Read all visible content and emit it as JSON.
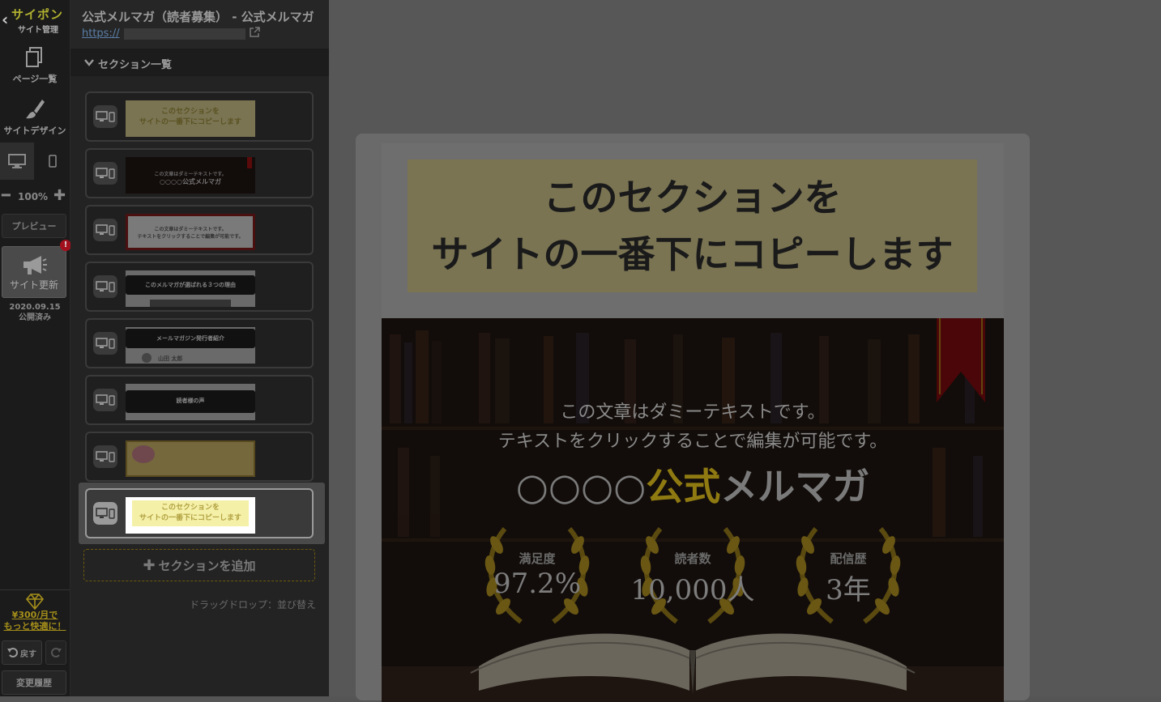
{
  "toolbar": {
    "logo_brand": "サイポン",
    "logo_sub": "サイト管理",
    "pages_label": "ページ一覧",
    "design_label": "サイトデザイン",
    "zoom": "100%",
    "preview_label": "プレビュー",
    "update_label": "サイト更新",
    "alert": "!",
    "update_date": "2020.09.15",
    "update_status": "公開済み",
    "promo_line1": "¥300/月で",
    "promo_line2": "もっと快適に！",
    "undo_label": "戻す",
    "history_label": "変更履歴"
  },
  "panel": {
    "site_title": "公式メルマガ（読者募集） - 公式メルマガ",
    "site_url": "https://",
    "section_header": "セクション一覧",
    "sections": [
      {
        "line1": "このセクションを",
        "line2": "サイトの一番下にコピーします"
      },
      {
        "line1": "この文章はダミーテキストです。",
        "line2": "○○○○公式メルマガ"
      },
      {
        "line1": "この文章はダミーテキストです。",
        "line2": "テキストをクリックすることで編集が可能です。"
      },
      {
        "line1": "このメルマガが選ばれる３つの理由",
        "line2": ""
      },
      {
        "line1": "メールマガジン発行者紹介",
        "line2": "山田 太郎"
      },
      {
        "line1": "読者様の声",
        "line2": ""
      },
      {
        "line1": "",
        "line2": ""
      },
      {
        "line1": "このセクションを",
        "line2": "サイトの一番下にコピーします"
      }
    ],
    "add_section_label": "セクションを追加",
    "drag_hint": "ドラッグドロップ：並び替え"
  },
  "preview": {
    "banner_line1": "このセクションを",
    "banner_line2": "サイトの一番下にコピーします",
    "hero_line1": "この文章はダミーテキストです。",
    "hero_line2": "テキストをクリックすることで編集が可能です。",
    "hero_title_prefix": "○○○○",
    "hero_title_gold": "公式",
    "hero_title_suffix": "メルマガ",
    "stats": [
      {
        "label": "満足度",
        "value": "97.2%"
      },
      {
        "label": "読者数",
        "value": "10,000人"
      },
      {
        "label": "配信歴",
        "value": "3年"
      }
    ]
  },
  "colors": {
    "accent_gold": "#8f7a12",
    "alert_red": "#a3101d",
    "banner_yellow": "#7a7453"
  }
}
